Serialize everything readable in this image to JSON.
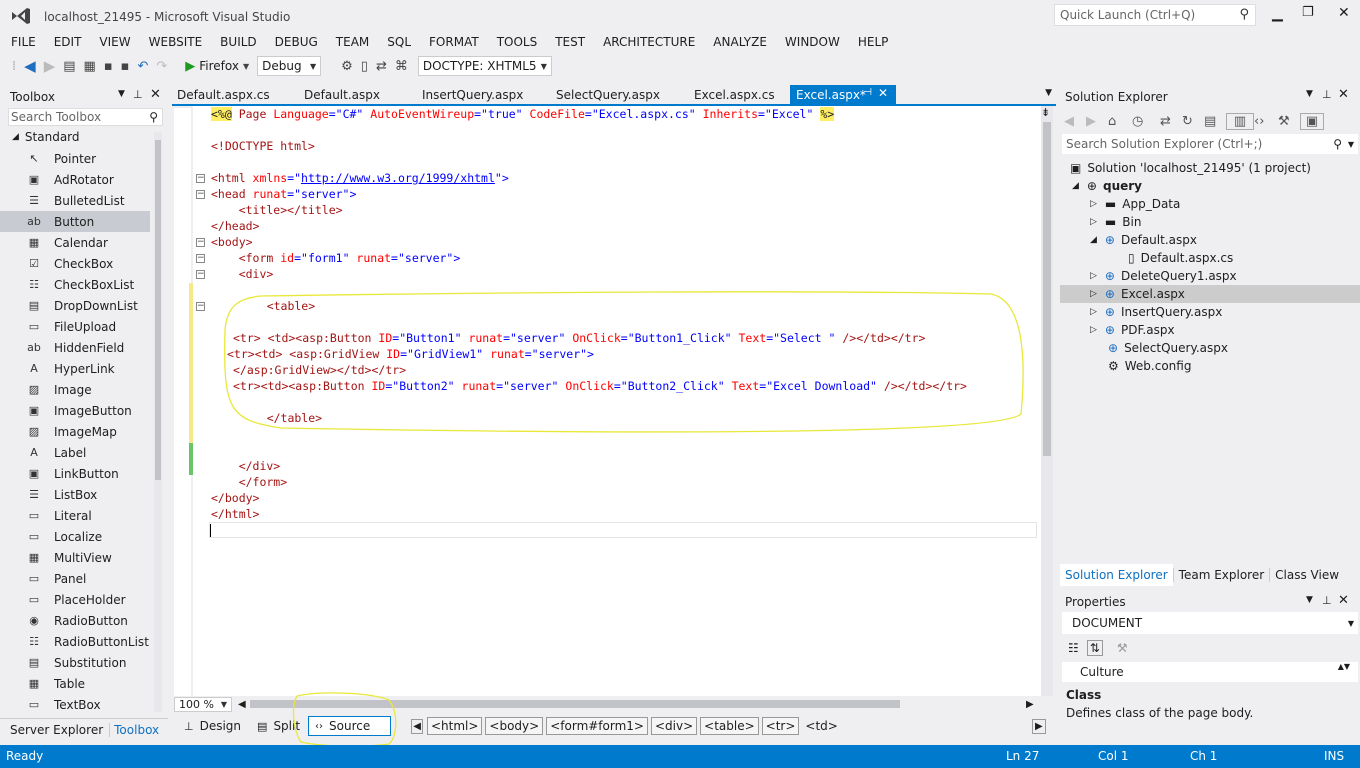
{
  "title": {
    "text": "localhost_21495 - Microsoft Visual Studio",
    "quick_launch": "Quick Launch (Ctrl+Q)"
  },
  "menu": [
    "FILE",
    "EDIT",
    "VIEW",
    "WEBSITE",
    "BUILD",
    "DEBUG",
    "TEAM",
    "SQL",
    "FORMAT",
    "TOOLS",
    "TEST",
    "ARCHITECTURE",
    "ANALYZE",
    "WINDOW",
    "HELP"
  ],
  "toolbar": {
    "browser": "Firefox",
    "config": "Debug",
    "doctype": "DOCTYPE: XHTML5"
  },
  "toolbox": {
    "title": "Toolbox",
    "search_placeholder": "Search Toolbox",
    "group": "Standard",
    "items": [
      "Pointer",
      "AdRotator",
      "BulletedList",
      "Button",
      "Calendar",
      "CheckBox",
      "CheckBoxList",
      "DropDownList",
      "FileUpload",
      "HiddenField",
      "HyperLink",
      "Image",
      "ImageButton",
      "ImageMap",
      "Label",
      "LinkButton",
      "ListBox",
      "Literal",
      "Localize",
      "MultiView",
      "Panel",
      "PlaceHolder",
      "RadioButton",
      "RadioButtonList",
      "Substitution",
      "Table",
      "TextBox"
    ],
    "icons": [
      "↖",
      "▣",
      "☰",
      "ab",
      "▦",
      "☑",
      "☷",
      "▤",
      "▭",
      "ab",
      "A",
      "▨",
      "▣",
      "▨",
      "A",
      "▣",
      "☰",
      "▭",
      "▭",
      "▦",
      "▭",
      "▭",
      "◉",
      "☷",
      "▤",
      "▦",
      "▭"
    ],
    "selected_index": 3,
    "bottom_tabs": [
      "Server Explorer",
      "Toolbox"
    ]
  },
  "editor": {
    "tabs": [
      "Default.aspx.cs",
      "Default.aspx",
      "InsertQuery.aspx",
      "SelectQuery.aspx",
      "Excel.aspx.cs",
      "Excel.aspx*"
    ],
    "active_tab": 5,
    "zoom": "100 %",
    "views": [
      "Design",
      "Split",
      "Source"
    ],
    "breadcrumbs": [
      "<html>",
      "<body>",
      "<form#form1>",
      "<div>",
      "<table>",
      "<tr>",
      "<td>"
    ],
    "code": {
      "l1a": "<%@",
      "l1b": " Page ",
      "l1c": "Language",
      "l1d": "=\"C#\" ",
      "l1e": "AutoEventWireup",
      "l1f": "=\"true\" ",
      "l1g": "CodeFile",
      "l1h": "=\"Excel.aspx.cs\" ",
      "l1i": "Inherits",
      "l1j": "=\"Excel\" ",
      "l1k": "%>",
      "l2": "<!DOCTYPE html>",
      "l3a": "<html ",
      "l3b": "xmlns",
      "l3c": "=\"",
      "l3d": "http://www.w3.org/1999/xhtml",
      "l3e": "\">",
      "l4a": "<head ",
      "l4b": "runat",
      "l4c": "=\"server\">",
      "l5a": "    <title></title>",
      "l6": "</head>",
      "l7": "<body>",
      "l8a": "    <form ",
      "l8b": "id",
      "l8c": "=\"form1\" ",
      "l8d": "runat",
      "l8e": "=\"server\">",
      "l9": "    <div>",
      "l10": "    <table>",
      "l11a": "<tr> <td><asp:Button ",
      "l11b": "ID",
      "l11c": "=\"Button1\" ",
      "l11d": "runat",
      "l11e": "=\"server\" ",
      "l11f": "OnClick",
      "l11g": "=\"Button1_Click\" ",
      "l11h": "Text",
      "l11i": "=\"Select \" ",
      "l11j": "/></td></tr>",
      "l12a": "<tr><td> <asp:GridView ",
      "l12b": "ID",
      "l12c": "=\"GridView1\" ",
      "l12d": "runat",
      "l12e": "=\"server\">",
      "l13": "</asp:GridView></td></tr>",
      "l14a": "<tr><td><asp:Button ",
      "l14b": "ID",
      "l14c": "=\"Button2\" ",
      "l14d": "runat",
      "l14e": "=\"server\" ",
      "l14f": "OnClick",
      "l14g": "=\"Button2_Click\" ",
      "l14h": "Text",
      "l14i": "=\"Excel Download\" ",
      "l14j": "/></td></tr>",
      "l15": "    </table>",
      "l16": "    </div>",
      "l17": "    </form>",
      "l18": "</body>",
      "l19": "</html>"
    }
  },
  "solution": {
    "title": "Solution Explorer",
    "search_placeholder": "Search Solution Explorer (Ctrl+;)",
    "root": "Solution 'localhost_21495' (1 project)",
    "project": "query",
    "items": [
      "App_Data",
      "Bin",
      "Default.aspx",
      "Default.aspx.cs",
      "DeleteQuery1.aspx",
      "Excel.aspx",
      "InsertQuery.aspx",
      "PDF.aspx",
      "SelectQuery.aspx",
      "Web.config"
    ],
    "bottom_tabs": [
      "Solution Explorer",
      "Team Explorer",
      "Class View"
    ]
  },
  "properties": {
    "title": "Properties",
    "object": "DOCUMENT",
    "row": "Culture",
    "desc_title": "Class",
    "desc_text": "Defines class of the page body."
  },
  "status": {
    "ready": "Ready",
    "ln": "Ln 27",
    "col": "Col 1",
    "ch": "Ch 1",
    "ins": "INS"
  }
}
